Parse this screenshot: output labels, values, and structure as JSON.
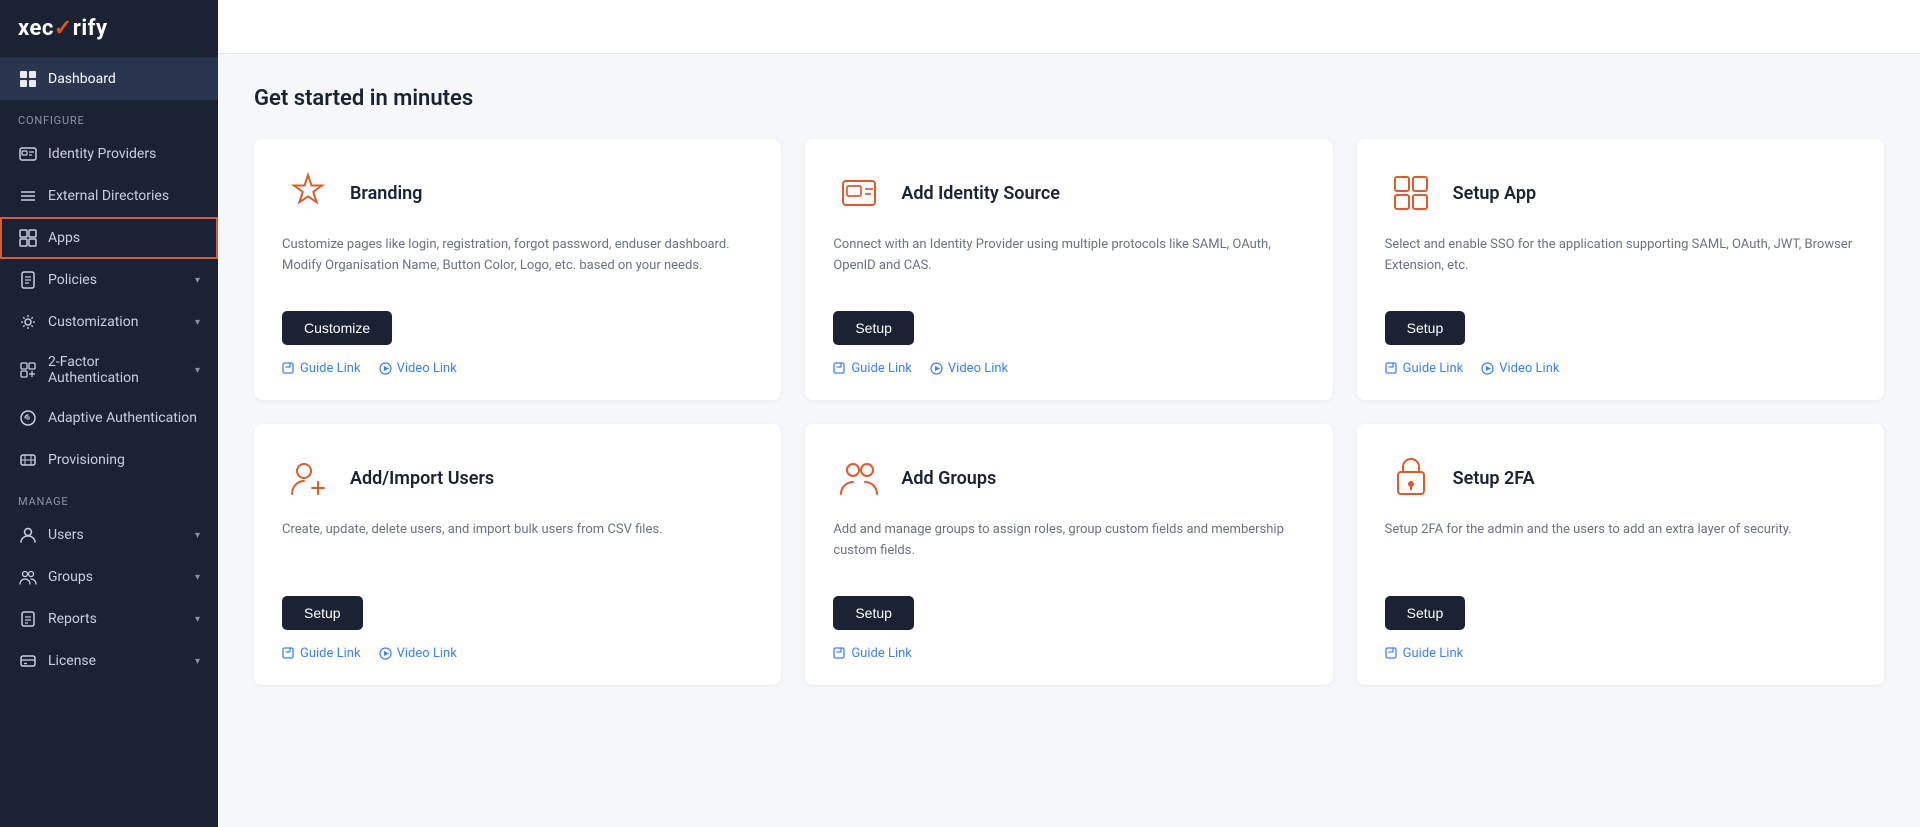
{
  "logo": {
    "text_before": "xec",
    "text_accent": "✓",
    "text_after": "rify"
  },
  "topbar": {
    "icons": [
      "book-icon",
      "settings-icon",
      "user-icon"
    ]
  },
  "sidebar": {
    "active_item": "dashboard",
    "highlighted_item": "apps",
    "sections": [
      {
        "id": "main",
        "items": [
          {
            "id": "dashboard",
            "label": "Dashboard",
            "icon": "grid-icon"
          }
        ]
      },
      {
        "id": "configure",
        "label": "Configure",
        "items": [
          {
            "id": "identity-providers",
            "label": "Identity Providers",
            "icon": "id-icon"
          },
          {
            "id": "external-directories",
            "label": "External Directories",
            "icon": "list-icon"
          },
          {
            "id": "apps",
            "label": "Apps",
            "icon": "apps-icon",
            "highlighted": true
          },
          {
            "id": "policies",
            "label": "Policies",
            "icon": "policy-icon",
            "hasChevron": true
          },
          {
            "id": "customization",
            "label": "Customization",
            "icon": "custom-icon",
            "hasChevron": true
          },
          {
            "id": "2fa",
            "label": "2-Factor Authentication",
            "icon": "2fa-icon",
            "hasChevron": true
          },
          {
            "id": "adaptive-auth",
            "label": "Adaptive Authentication",
            "icon": "adaptive-icon"
          },
          {
            "id": "provisioning",
            "label": "Provisioning",
            "icon": "prov-icon"
          }
        ]
      },
      {
        "id": "manage",
        "label": "Manage",
        "items": [
          {
            "id": "users",
            "label": "Users",
            "icon": "user-nav-icon",
            "hasChevron": true
          },
          {
            "id": "groups",
            "label": "Groups",
            "icon": "groups-icon",
            "hasChevron": true
          },
          {
            "id": "reports",
            "label": "Reports",
            "icon": "reports-icon",
            "hasChevron": true
          },
          {
            "id": "license",
            "label": "License",
            "icon": "license-icon",
            "hasChevron": true
          }
        ]
      }
    ]
  },
  "main": {
    "title": "Get started in minutes",
    "cards": [
      {
        "id": "branding",
        "title": "Branding",
        "description": "Customize pages like login, registration, forgot password, enduser dashboard. Modify Organisation Name, Button Color, Logo, etc. based on your needs.",
        "button_label": "Customize",
        "links": [
          {
            "id": "guide",
            "label": "Guide Link",
            "icon": "external-link-icon"
          },
          {
            "id": "video",
            "label": "Video Link",
            "icon": "play-icon"
          }
        ]
      },
      {
        "id": "add-identity-source",
        "title": "Add Identity Source",
        "description": "Connect with an Identity Provider using multiple protocols like SAML, OAuth, OpenID and CAS.",
        "button_label": "Setup",
        "links": [
          {
            "id": "guide",
            "label": "Guide Link",
            "icon": "external-link-icon"
          },
          {
            "id": "video",
            "label": "Video Link",
            "icon": "play-icon"
          }
        ]
      },
      {
        "id": "setup-app",
        "title": "Setup App",
        "description": "Select and enable SSO for the application supporting SAML, OAuth, JWT, Browser Extension, etc.",
        "button_label": "Setup",
        "links": [
          {
            "id": "guide",
            "label": "Guide Link",
            "icon": "external-link-icon"
          },
          {
            "id": "video",
            "label": "Video Link",
            "icon": "play-icon"
          }
        ]
      },
      {
        "id": "add-import-users",
        "title": "Add/Import Users",
        "description": "Create, update, delete users, and import bulk users from CSV files.",
        "button_label": "Setup",
        "links": [
          {
            "id": "guide",
            "label": "Guide Link",
            "icon": "external-link-icon"
          },
          {
            "id": "video",
            "label": "Video Link",
            "icon": "play-icon"
          }
        ]
      },
      {
        "id": "add-groups",
        "title": "Add Groups",
        "description": "Add and manage groups to assign roles, group custom fields and membership custom fields.",
        "button_label": "Setup",
        "links": [
          {
            "id": "guide",
            "label": "Guide Link",
            "icon": "external-link-icon"
          }
        ]
      },
      {
        "id": "setup-2fa",
        "title": "Setup 2FA",
        "description": "Setup 2FA for the admin and the users to add an extra layer of security.",
        "button_label": "Setup",
        "links": [
          {
            "id": "guide",
            "label": "Guide Link",
            "icon": "external-link-icon"
          }
        ]
      }
    ]
  }
}
